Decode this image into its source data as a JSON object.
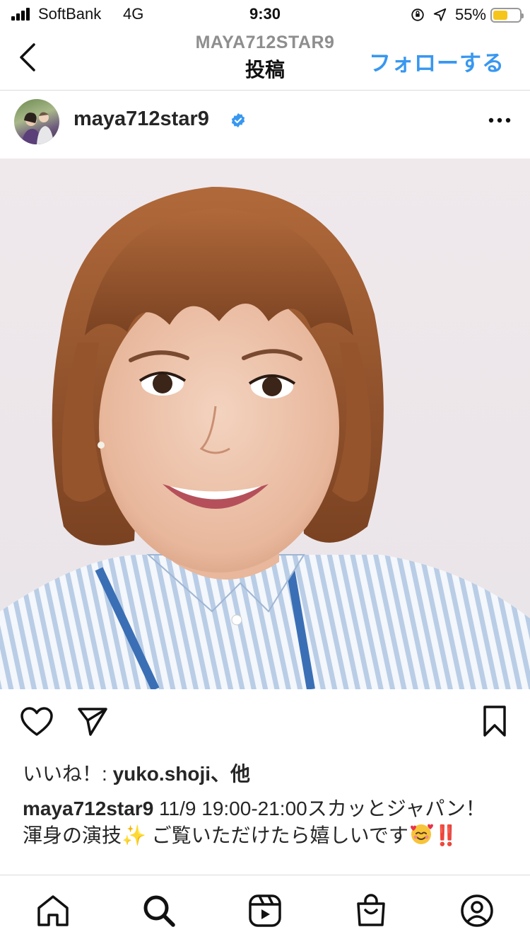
{
  "status_bar": {
    "carrier": "SoftBank",
    "network": "4G",
    "time": "9:30",
    "battery_percent_text": "55%",
    "battery_level": 0.55,
    "battery_color": "#f5c51c"
  },
  "nav": {
    "account": "MAYA712STAR9",
    "title": "投稿",
    "follow_label": "フォローする",
    "follow_color": "#3897f0"
  },
  "post": {
    "username": "maya712star9",
    "verified": true,
    "likes_prefix": "いいね！: ",
    "likes_user": "yuko.shoji",
    "likes_suffix": "、他",
    "caption_user": "maya712star9",
    "caption_line1": " 11/9 19:00-21:00スカッとジャパン！",
    "caption_line2_text": "渾身の演技",
    "caption_line2_sparkle": "✨",
    "caption_line2_rest": " ご覧いただけたら嬉しいです",
    "caption_line2_bangs": "‼️"
  },
  "icons": {
    "back": "chevron-left-icon",
    "more": "more-horizontal-icon",
    "like": "heart-icon",
    "share": "send-icon",
    "save": "bookmark-icon",
    "tabs": [
      "home-icon",
      "search-icon",
      "reels-icon",
      "shop-icon",
      "profile-icon"
    ]
  }
}
